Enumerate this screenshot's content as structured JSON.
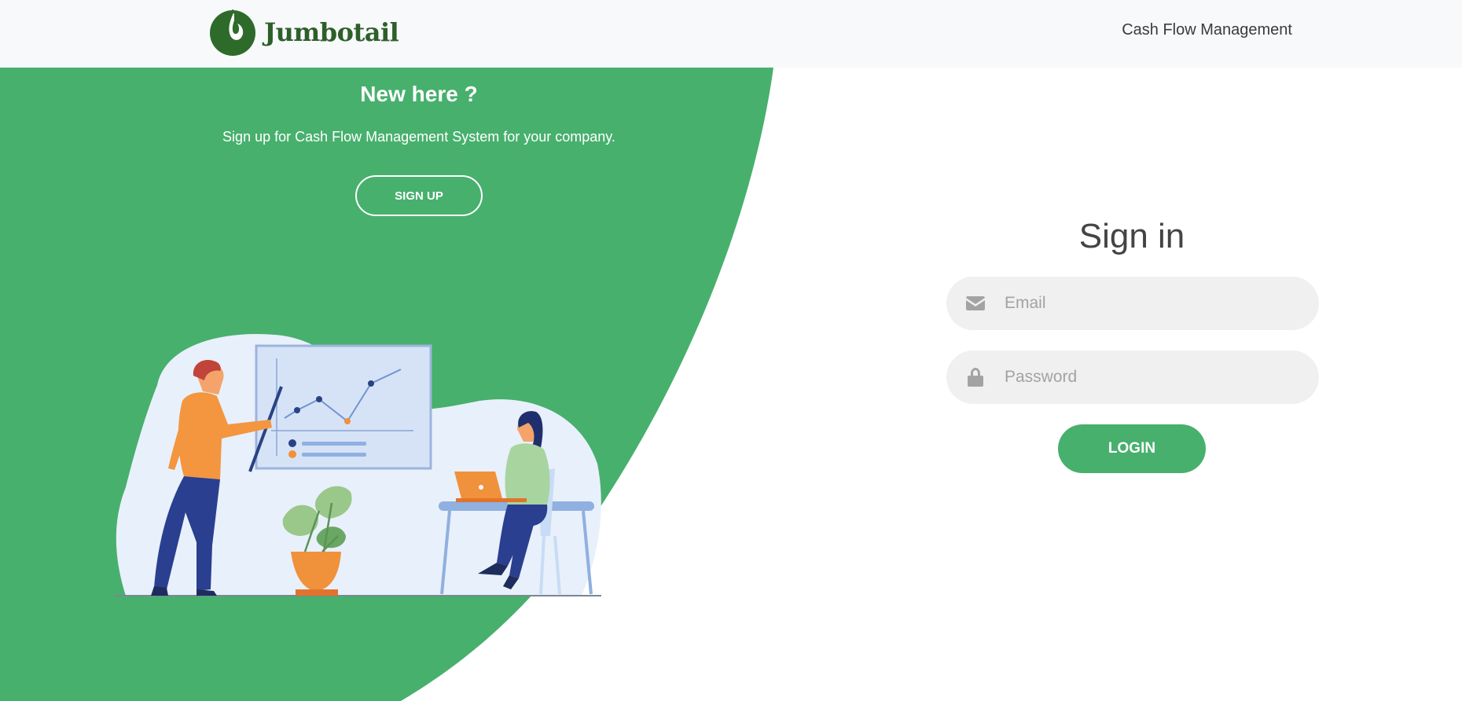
{
  "brand": {
    "name": "Jumbotail",
    "color": "#2e5f2b"
  },
  "nav": {
    "link_label": "Cash Flow Management"
  },
  "left": {
    "title": "New here ?",
    "description": "Sign up for Cash Flow Management System for your company.",
    "signup_label": "SIGN UP",
    "illustration": "two-people-presenting-chart-illustration"
  },
  "signin": {
    "title": "Sign in",
    "email": {
      "placeholder": "Email",
      "value": "",
      "icon": "envelope-icon"
    },
    "password": {
      "placeholder": "Password",
      "value": "",
      "icon": "lock-icon"
    },
    "login_label": "LOGIN"
  },
  "colors": {
    "accent": "#47b06d",
    "navbar_bg": "#f8f9fa",
    "field_bg": "#f0f0f0"
  }
}
